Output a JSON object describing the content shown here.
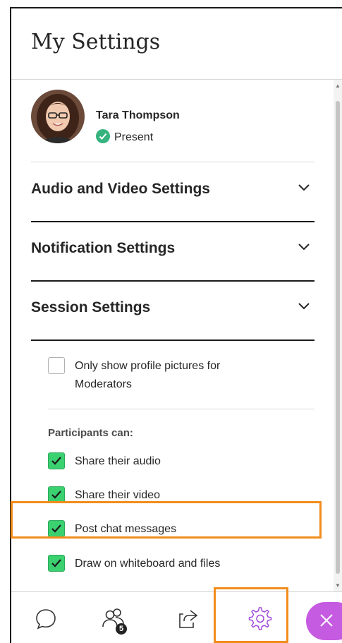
{
  "panel": {
    "title": "My Settings"
  },
  "user": {
    "name": "Tara Thompson",
    "status": "Present"
  },
  "sections": [
    {
      "label": "Audio and Video Settings",
      "icon": "chevron-down-icon"
    },
    {
      "label": "Notification Settings",
      "icon": "chevron-down-icon"
    },
    {
      "label": "Session Settings",
      "icon": "chevron-down-icon"
    }
  ],
  "session": {
    "profile_option": {
      "label": "Only show profile pictures for Moderators",
      "checked": false
    },
    "participants_title": "Participants can:",
    "permissions": [
      {
        "label": "Share their audio",
        "checked": true
      },
      {
        "label": "Share their video",
        "checked": true
      },
      {
        "label": "Post chat messages",
        "checked": true
      },
      {
        "label": "Draw on whiteboard and files",
        "checked": true
      }
    ]
  },
  "tabbar": {
    "tabs": [
      {
        "name": "chat",
        "icon": "chat-bubble-icon"
      },
      {
        "name": "attendees",
        "icon": "people-icon",
        "badge": "5"
      },
      {
        "name": "share-content",
        "icon": "share-icon"
      },
      {
        "name": "my-settings",
        "icon": "gear-icon"
      }
    ],
    "close_icon": "close-icon"
  },
  "colors": {
    "accent_highlight": "#f28c1b",
    "checkbox_green": "#3bd070",
    "present_green": "#36b37e",
    "gear_purple": "#a14ad9",
    "close_purple": "#c55be0"
  }
}
